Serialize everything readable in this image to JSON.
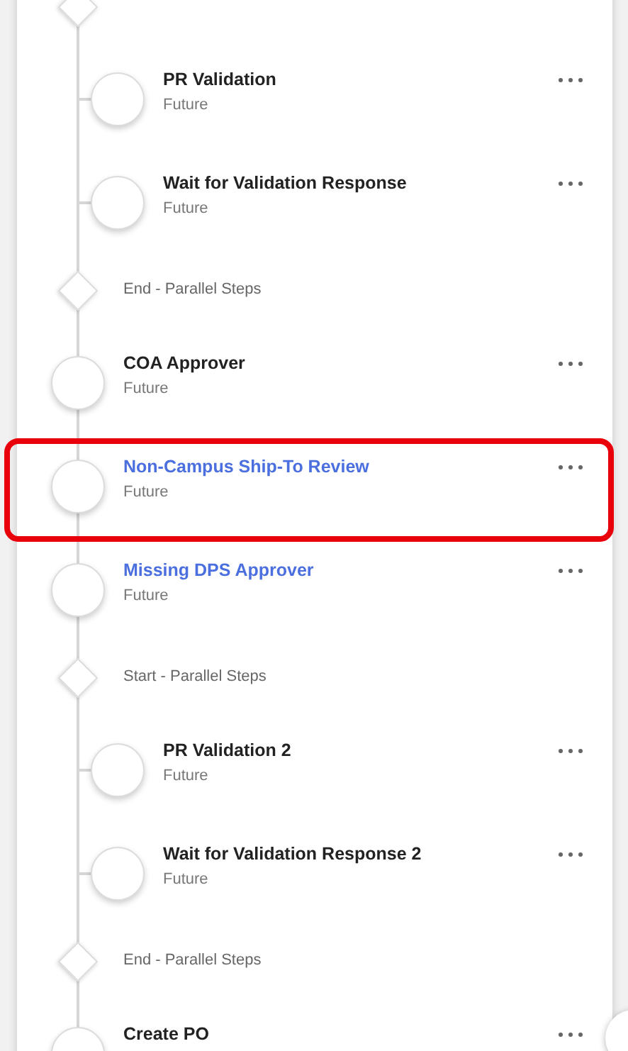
{
  "timeline": [
    {
      "kind": "marker"
    },
    {
      "kind": "group",
      "children": [
        {
          "kind": "step",
          "title": "PR Validation",
          "status": "Future",
          "linked": false,
          "highlighted": false
        },
        {
          "kind": "step",
          "title": "Wait for Validation Response",
          "status": "Future",
          "linked": false,
          "highlighted": false
        }
      ]
    },
    {
      "kind": "marker",
      "label": "End - Parallel Steps"
    },
    {
      "kind": "step",
      "title": "COA Approver",
      "status": "Future",
      "linked": false,
      "highlighted": false
    },
    {
      "kind": "step",
      "title": "Non-Campus Ship-To Review",
      "status": "Future",
      "linked": true,
      "highlighted": true
    },
    {
      "kind": "step",
      "title": "Missing DPS Approver",
      "status": "Future",
      "linked": true,
      "highlighted": false
    },
    {
      "kind": "marker",
      "label": "Start - Parallel Steps"
    },
    {
      "kind": "group",
      "children": [
        {
          "kind": "step",
          "title": "PR Validation 2",
          "status": "Future",
          "linked": false,
          "highlighted": false
        },
        {
          "kind": "step",
          "title": "Wait for Validation Response 2",
          "status": "Future",
          "linked": false,
          "highlighted": false
        }
      ]
    },
    {
      "kind": "marker",
      "label": "End - Parallel Steps"
    },
    {
      "kind": "step",
      "title": "Create PO",
      "linked": false,
      "highlighted": false
    }
  ]
}
